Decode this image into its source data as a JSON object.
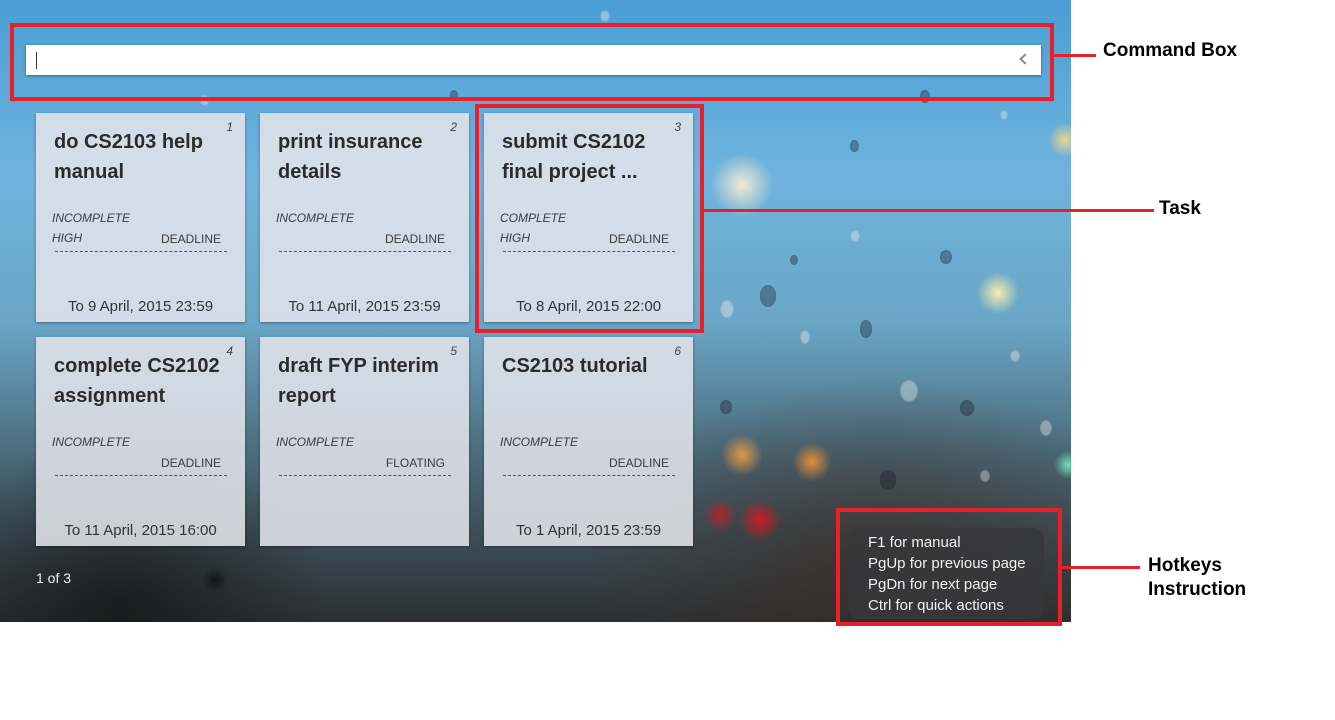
{
  "command_box": {
    "value": "",
    "collapse_icon": "chevron-left-icon"
  },
  "tasks": [
    {
      "index": "1",
      "title": "do CS2103 help manual",
      "status": "INCOMPLETE",
      "priority": "HIGH",
      "type": "DEADLINE",
      "date": "To 9 April, 2015 23:59"
    },
    {
      "index": "2",
      "title": "print insurance details",
      "status": "INCOMPLETE",
      "priority": "",
      "type": "DEADLINE",
      "date": "To 11 April, 2015 23:59"
    },
    {
      "index": "3",
      "title": "submit CS2102 final project ...",
      "status": "COMPLETE",
      "priority": "HIGH",
      "type": "DEADLINE",
      "date": "To 8 April, 2015 22:00"
    },
    {
      "index": "4",
      "title": "complete CS2102 assignment",
      "status": "INCOMPLETE",
      "priority": "",
      "type": "DEADLINE",
      "date": "To 11 April, 2015 16:00"
    },
    {
      "index": "5",
      "title": "draft FYP interim report",
      "status": "INCOMPLETE",
      "priority": "",
      "type": "FLOATING",
      "date": ""
    },
    {
      "index": "6",
      "title": "CS2103 tutorial",
      "status": "INCOMPLETE",
      "priority": "",
      "type": "DEADLINE",
      "date": "To 1 April, 2015 23:59"
    }
  ],
  "page_indicator": "1 of 3",
  "hotkeys": [
    "F1 for manual",
    "PgUp for previous page",
    "PgDn for next page",
    "Ctrl for quick actions"
  ],
  "annotations": {
    "command_box": "Command Box",
    "task": "Task",
    "hotkeys_line1": "Hotkeys",
    "hotkeys_line2": "Instruction",
    "color": "#e8202c"
  }
}
